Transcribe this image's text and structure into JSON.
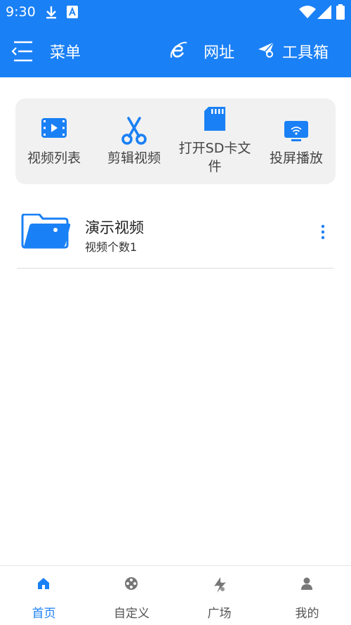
{
  "status_bar": {
    "time": "9:30"
  },
  "app_bar": {
    "title": "菜单",
    "url_label": "网址",
    "tools_label": "工具箱"
  },
  "quick_actions": [
    {
      "label": "视频列表",
      "icon": "video-list-icon"
    },
    {
      "label": "剪辑视频",
      "icon": "scissors-icon"
    },
    {
      "label": "打开SD卡文件",
      "icon": "sd-card-icon"
    },
    {
      "label": "投屏播放",
      "icon": "cast-screen-icon"
    }
  ],
  "folder": {
    "name": "演示视频",
    "count_text": "视频个数1",
    "icon": "folder-icon"
  },
  "bottom_nav": [
    {
      "label": "首页",
      "icon": "home-icon",
      "active": true
    },
    {
      "label": "自定义",
      "icon": "film-reel-icon",
      "active": false
    },
    {
      "label": "广场",
      "icon": "plaza-icon",
      "active": false
    },
    {
      "label": "我的",
      "icon": "person-icon",
      "active": false
    }
  ],
  "colors": {
    "primary": "#1a80f5",
    "card_bg": "#f1f1f1",
    "text": "#444444"
  }
}
